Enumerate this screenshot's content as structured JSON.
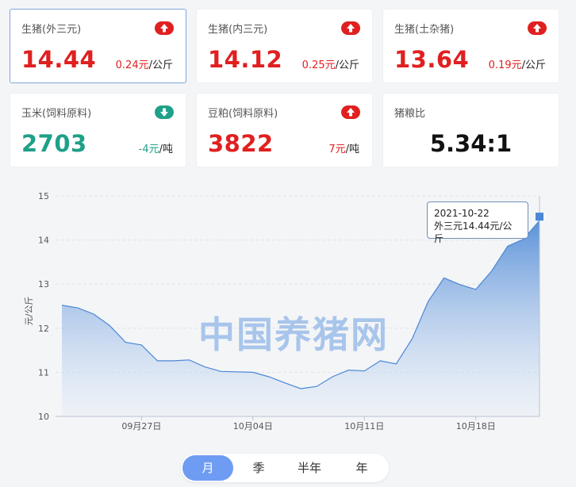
{
  "cards": [
    {
      "label": "生猪(外三元)",
      "value": "14.44",
      "change": "0.24元",
      "unit": "/公斤",
      "direction": "up"
    },
    {
      "label": "生猪(内三元)",
      "value": "14.12",
      "change": "0.25元",
      "unit": "/公斤",
      "direction": "up"
    },
    {
      "label": "生猪(土杂猪)",
      "value": "13.64",
      "change": "0.19元",
      "unit": "/公斤",
      "direction": "up"
    },
    {
      "label": "玉米(饲料原料)",
      "value": "2703",
      "change": "-4元",
      "unit": "/吨",
      "direction": "down"
    },
    {
      "label": "豆粕(饲料原料)",
      "value": "3822",
      "change": "7元",
      "unit": "/吨",
      "direction": "up"
    },
    {
      "label": "猪粮比",
      "value": "5.34:1"
    }
  ],
  "colors": {
    "up": "#e02020",
    "down": "#1fa088",
    "series": "#4a87d6",
    "accent": "#6e9cf2"
  },
  "chart_data": {
    "type": "area",
    "ylabel": "元/公斤",
    "ylim": [
      10,
      15
    ],
    "yticks": [
      "10",
      "11",
      "12",
      "13",
      "14",
      "15"
    ],
    "xtick_labels": [
      "09月27日",
      "10月04日",
      "10月11日",
      "10月18日"
    ],
    "x": [
      "2021-09-22",
      "2021-09-23",
      "2021-09-24",
      "2021-09-25",
      "2021-09-26",
      "2021-09-27",
      "2021-09-28",
      "2021-09-29",
      "2021-09-30",
      "2021-10-01",
      "2021-10-02",
      "2021-10-03",
      "2021-10-04",
      "2021-10-05",
      "2021-10-06",
      "2021-10-07",
      "2021-10-08",
      "2021-10-09",
      "2021-10-10",
      "2021-10-11",
      "2021-10-12",
      "2021-10-13",
      "2021-10-14",
      "2021-10-15",
      "2021-10-16",
      "2021-10-17",
      "2021-10-18",
      "2021-10-19",
      "2021-10-20",
      "2021-10-21",
      "2021-10-22"
    ],
    "values": [
      12.52,
      12.46,
      12.32,
      12.06,
      11.68,
      11.62,
      11.26,
      11.26,
      11.28,
      11.12,
      11.02,
      11.01,
      11.0,
      10.9,
      10.76,
      10.63,
      10.68,
      10.9,
      11.05,
      11.03,
      11.26,
      11.19,
      11.76,
      12.6,
      13.14,
      12.99,
      12.88,
      13.3,
      13.86,
      14.02,
      14.44
    ],
    "grid": true,
    "watermark": "中国养猪网"
  },
  "tooltip": {
    "date": "2021-10-22",
    "line": "外三元14.44元/公斤"
  },
  "periods": {
    "month": "月",
    "quarter": "季",
    "half_year": "半年",
    "year": "年"
  }
}
